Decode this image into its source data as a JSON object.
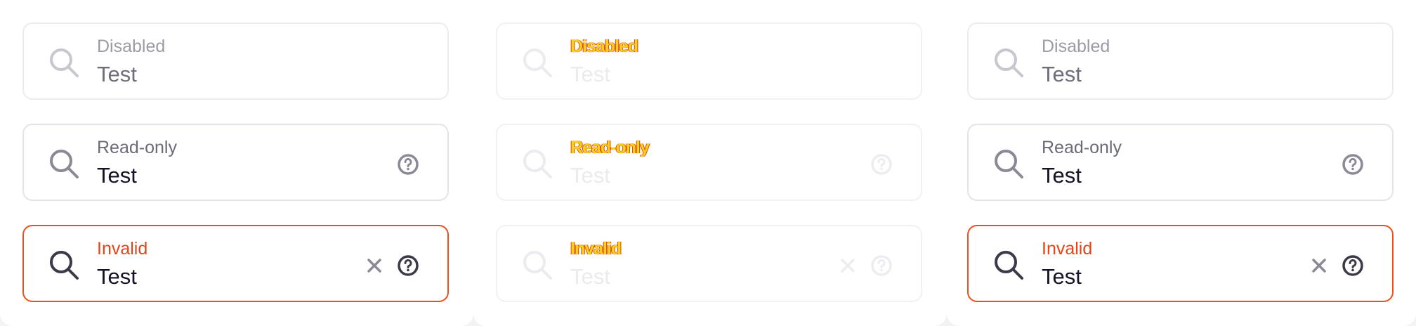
{
  "panels": [
    {
      "fields": [
        {
          "label": "Disabled",
          "value": "Test",
          "state": "disabled"
        },
        {
          "label": "Read-only",
          "value": "Test",
          "state": "readonly"
        },
        {
          "label": "Invalid",
          "value": "Test",
          "state": "invalid"
        }
      ]
    },
    {
      "fields": [
        {
          "label": "Disabled",
          "value": "Test",
          "state": "ghost"
        },
        {
          "label": "Read-only",
          "value": "Test",
          "state": "ghost"
        },
        {
          "label": "Invalid",
          "value": "Test",
          "state": "ghost"
        }
      ]
    },
    {
      "fields": [
        {
          "label": "Disabled",
          "value": "Test",
          "state": "disabled"
        },
        {
          "label": "Read-only",
          "value": "Test",
          "state": "readonly"
        },
        {
          "label": "Invalid",
          "value": "Test",
          "state": "invalid"
        }
      ]
    }
  ],
  "icons": {
    "search": "search-icon",
    "clear": "close-icon",
    "help": "help-circle-icon"
  },
  "colors": {
    "invalid_border": "#e8501f",
    "invalid_label": "#e0461a",
    "text": "#131325"
  }
}
